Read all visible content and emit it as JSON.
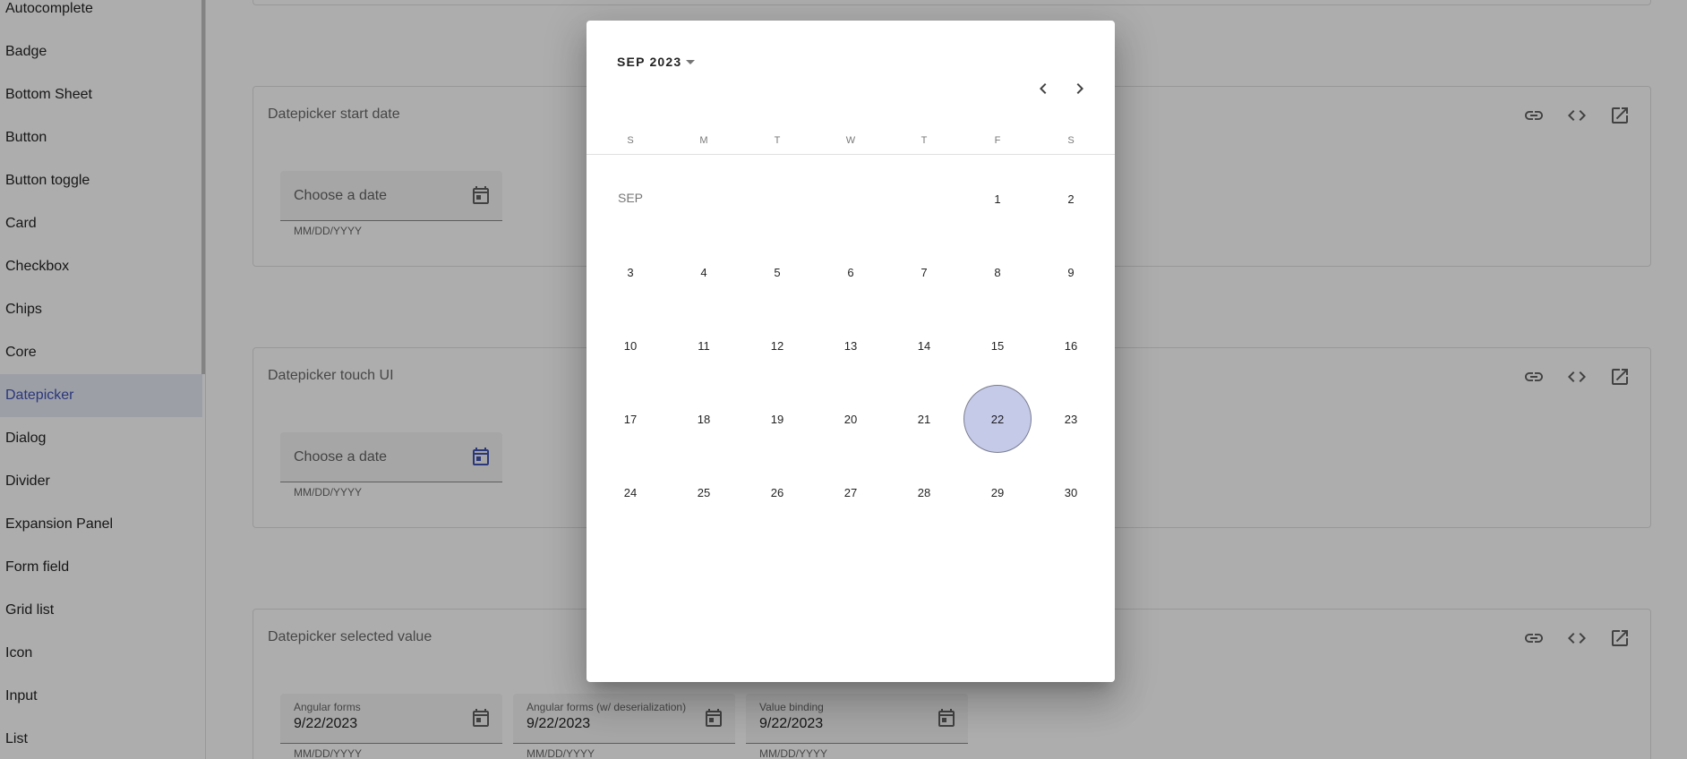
{
  "sidebar": {
    "items": [
      {
        "label": "Autocomplete"
      },
      {
        "label": "Badge"
      },
      {
        "label": "Bottom Sheet"
      },
      {
        "label": "Button"
      },
      {
        "label": "Button toggle"
      },
      {
        "label": "Card"
      },
      {
        "label": "Checkbox"
      },
      {
        "label": "Chips"
      },
      {
        "label": "Core"
      },
      {
        "label": "Datepicker"
      },
      {
        "label": "Dialog"
      },
      {
        "label": "Divider"
      },
      {
        "label": "Expansion Panel"
      },
      {
        "label": "Form field"
      },
      {
        "label": "Grid list"
      },
      {
        "label": "Icon"
      },
      {
        "label": "Input"
      },
      {
        "label": "List"
      }
    ],
    "active_index": 9
  },
  "examples": {
    "start_date": {
      "title": "Datepicker start date",
      "placeholder": "Choose a date",
      "hint": "MM/DD/YYYY"
    },
    "touch_ui": {
      "title": "Datepicker touch UI",
      "placeholder": "Choose a date",
      "hint": "MM/DD/YYYY"
    },
    "selected_value": {
      "title": "Datepicker selected value",
      "fields": [
        {
          "label": "Angular forms",
          "value": "9/22/2023",
          "hint": "MM/DD/YYYY"
        },
        {
          "label": "Angular forms (w/ deserialization)",
          "value": "9/22/2023",
          "hint": "MM/DD/YYYY"
        },
        {
          "label": "Value binding",
          "value": "9/22/2023",
          "hint": "MM/DD/YYYY"
        }
      ]
    }
  },
  "calendar": {
    "period_label": "SEP 2023",
    "month_label": "SEP",
    "weekdays": [
      "S",
      "M",
      "T",
      "W",
      "T",
      "F",
      "S"
    ],
    "first_weekday_index": 5,
    "days_in_month": 30,
    "selected_day": 22,
    "selected_color": "#c5cae9"
  },
  "colors": {
    "accent": "#3f51b5",
    "active_nav_bg": "#e8eaf6"
  },
  "icons": {
    "card_actions": [
      "link-icon",
      "code-icon",
      "open-in-new-icon"
    ],
    "calendar": "calendar-icon",
    "prev": "chevron-left-icon",
    "next": "chevron-right-icon"
  }
}
